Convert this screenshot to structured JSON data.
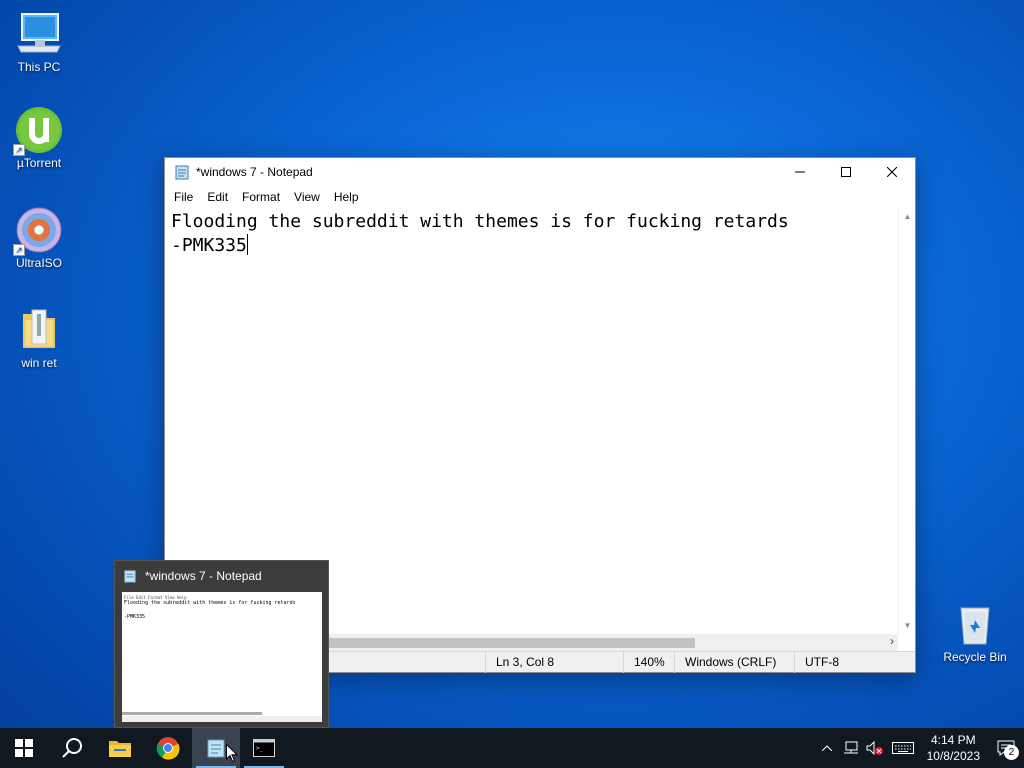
{
  "desktop": {
    "icons": [
      {
        "label": "This PC"
      },
      {
        "label": "µTorrent"
      },
      {
        "label": "UltraISO"
      },
      {
        "label": "win ret"
      },
      {
        "label": "Recycle Bin"
      }
    ]
  },
  "notepad": {
    "title": "*windows 7 - Notepad",
    "menu": [
      "File",
      "Edit",
      "Format",
      "View",
      "Help"
    ],
    "lines": [
      "Flooding the subreddit with themes is for fucking retards",
      "",
      "-PMK335"
    ],
    "status": {
      "position": "Ln 3, Col 8",
      "zoom": "140%",
      "line_ending": "Windows (CRLF)",
      "encoding": "UTF-8"
    }
  },
  "thumbnail": {
    "title": "*windows 7 - Notepad",
    "menu_text": "File  Edit  Format  View  Help",
    "line1": "Flooding the subreddit with themes is for fucking retards",
    "line3": "-PMK335"
  },
  "taskbar": {
    "time": "4:14 PM",
    "date": "10/8/2023",
    "notification_count": "2"
  }
}
